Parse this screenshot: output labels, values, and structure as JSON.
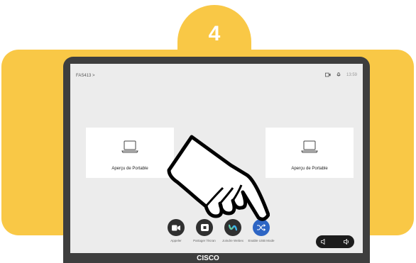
{
  "step": {
    "number": "4"
  },
  "device": {
    "brand": "CISCO"
  },
  "screen": {
    "room_name": "FAS413 >",
    "clock": "13:59",
    "status_icons": [
      "camera-status-icon",
      "microphone-status-icon"
    ],
    "tiles": [
      {
        "label": "Aperçu de Portable",
        "icon": "laptop-icon"
      },
      {
        "label": "Aperçu de Portable",
        "icon": "laptop-icon"
      }
    ],
    "actions": [
      {
        "label": "Appeler",
        "icon": "video-camera-icon",
        "color": "#303030"
      },
      {
        "label": "Partager l'écran",
        "icon": "share-screen-icon",
        "color": "#303030"
      },
      {
        "label": "Joindre Webex",
        "icon": "webex-icon",
        "color": "#303030"
      },
      {
        "label": "Enable USB Mode",
        "icon": "shuffle-icon",
        "color": "#2d65c4"
      }
    ],
    "volume": {
      "down_icon": "volume-down-icon",
      "up_icon": "volume-up-icon"
    }
  },
  "colors": {
    "accent_yellow": "#f9c846",
    "device_frame": "#3e3e3e",
    "screen_bg": "#ececec",
    "action_blue": "#2d65c4"
  }
}
